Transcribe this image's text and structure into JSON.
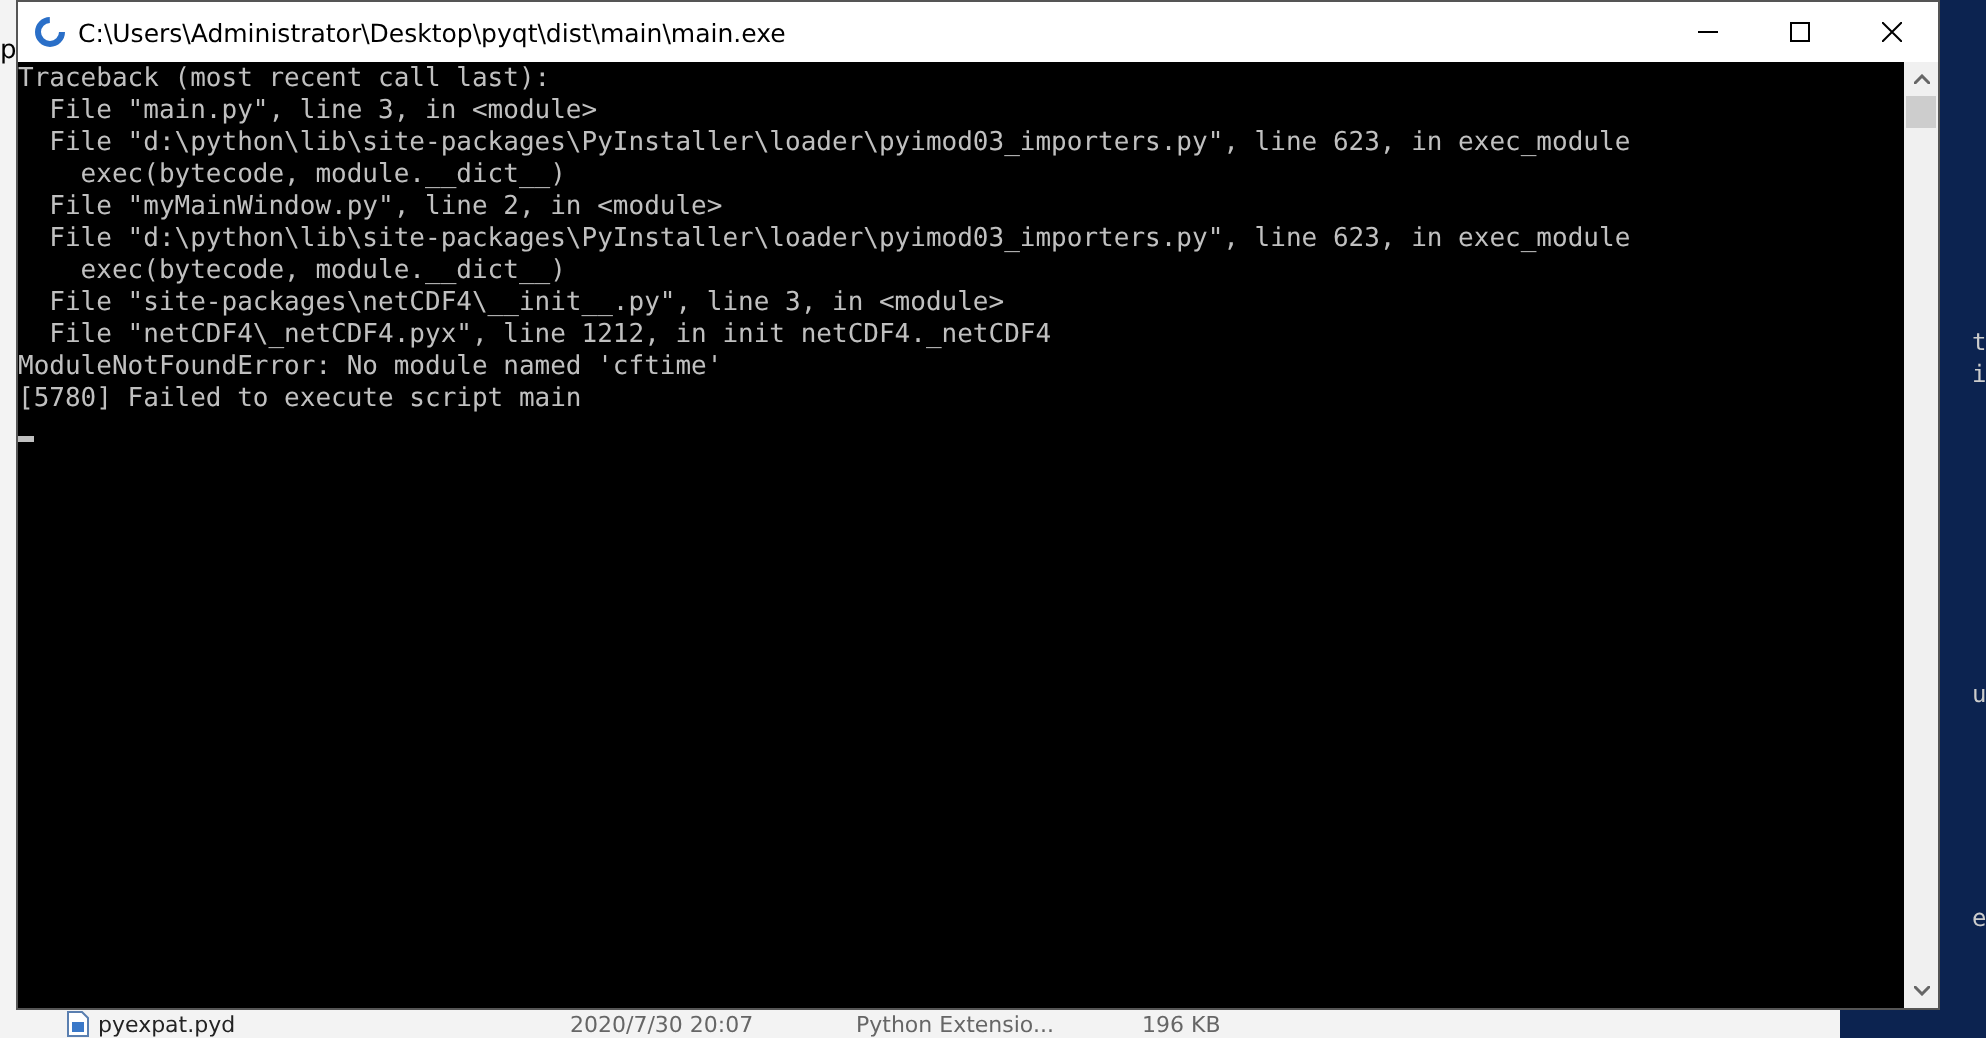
{
  "window": {
    "title": "C:\\Users\\Administrator\\Desktop\\pyqt\\dist\\main\\main.exe"
  },
  "console": {
    "lines": [
      "Traceback (most recent call last):",
      "  File \"main.py\", line 3, in <module>",
      "  File \"d:\\python\\lib\\site-packages\\PyInstaller\\loader\\pyimod03_importers.py\", line 623, in exec_module",
      "    exec(bytecode, module.__dict__)",
      "  File \"myMainWindow.py\", line 2, in <module>",
      "  File \"d:\\python\\lib\\site-packages\\PyInstaller\\loader\\pyimod03_importers.py\", line 623, in exec_module",
      "    exec(bytecode, module.__dict__)",
      "  File \"site-packages\\netCDF4\\__init__.py\", line 3, in <module>",
      "  File \"netCDF4\\_netCDF4.pyx\", line 1212, in init netCDF4._netCDF4",
      "ModuleNotFoundError: No module named 'cftime'",
      "[5780] Failed to execute script main"
    ]
  },
  "background": {
    "left_fragment": "p",
    "file_row": {
      "name": "pyexpat.pyd",
      "modified": "2020/7/30 20:07",
      "type": "Python Extensio...",
      "size": "196 KB"
    },
    "terminal_fragments": [
      "t",
      "i",
      "u",
      "e"
    ]
  }
}
